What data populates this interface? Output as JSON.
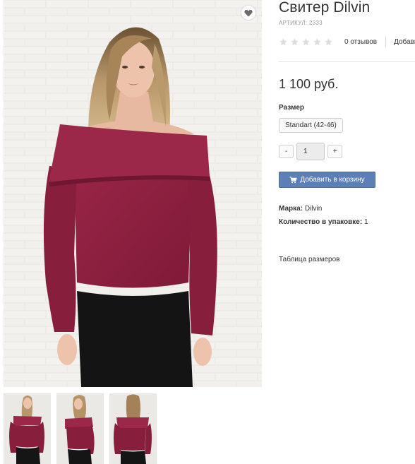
{
  "product": {
    "title": "Свитер Dilvin",
    "sku_label": "АРТИКУЛ:",
    "sku_value": "2333",
    "rating": {
      "stars_filled": 0,
      "stars_total": 5,
      "reviews_text": "0 отзывов",
      "add_review_text": "Добавить отзыв"
    },
    "price": "1 100 руб.",
    "size": {
      "label": "Размер",
      "selected": "Standart (42-46)"
    },
    "quantity": {
      "minus": "-",
      "value": "1",
      "plus": "+"
    },
    "add_to_cart": "Добавить в корзину",
    "specs": [
      {
        "label": "Марка:",
        "value": "Dilvin"
      },
      {
        "label": "Количество в упаковке:",
        "value": "1"
      }
    ],
    "size_table_link": "Таблица размеров"
  },
  "gallery": {
    "main_image": "model-in-burgundy-off-shoulder-sweater",
    "wishlist_icon": "heart-icon",
    "thumbnails": [
      "front-view",
      "side-view",
      "back-view"
    ]
  },
  "colors": {
    "sweater": "#8c1e3d",
    "button": "#5b7fb6",
    "star_empty": "#dddddd"
  }
}
